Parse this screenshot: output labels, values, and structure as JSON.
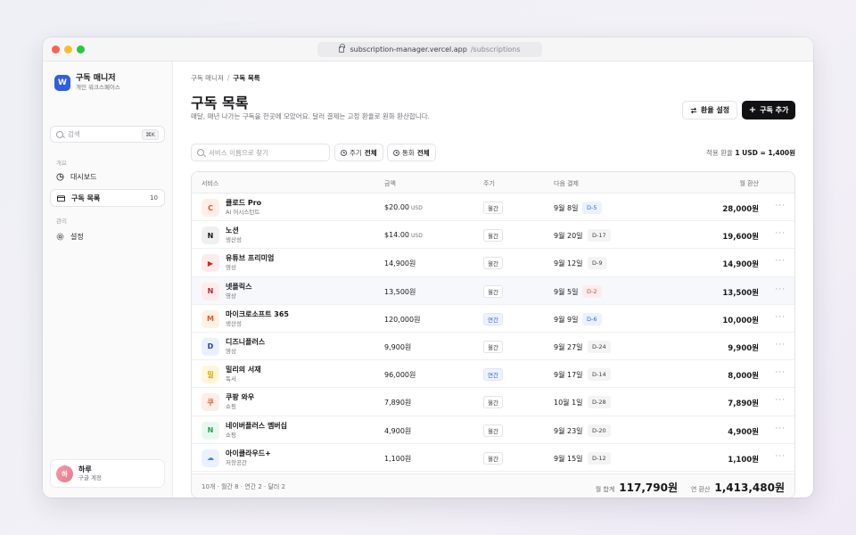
{
  "browser": {
    "url_host": "subscription-manager.vercel.app",
    "url_path": "/subscriptions"
  },
  "sidebar": {
    "logo_letter": "W",
    "app_name": "구독 매니저",
    "workspace": "개인 워크스페이스",
    "search_placeholder": "검색",
    "search_shortcut": "⌘K",
    "section_overview": "개요",
    "items": [
      {
        "label": "대시보드",
        "icon": "pie-chart-icon"
      },
      {
        "label": "구독 목록",
        "icon": "card-icon",
        "count": "10",
        "active": true
      }
    ],
    "section_manage": "관리",
    "settings_label": "설정",
    "user": {
      "initial": "하",
      "name": "하루",
      "account": "구글 계정"
    }
  },
  "header": {
    "breadcrumb_root": "구독 매니저",
    "breadcrumb_current": "구독 목록",
    "title": "구독 목록",
    "description": "매달, 매년 나가는 구독을 한곳에 모았어요. 달러 결제는 고정 환율로 원화 환산합니다.",
    "rate_button": "환율 설정",
    "add_button": "구독 추가"
  },
  "filters": {
    "search_placeholder": "서비스 이름으로 찾기",
    "cycle_label": "주기",
    "cycle_value": "전체",
    "currency_label": "통화",
    "currency_value": "전체",
    "rate_label": "적용 환율",
    "rate_value": "1 USD = 1,400원"
  },
  "table": {
    "headers": {
      "service": "서비스",
      "amount": "금액",
      "cycle": "주기",
      "next": "다음 결제",
      "monthly": "월 환산"
    },
    "rows": [
      {
        "icon": "C",
        "name": "클로드 Pro",
        "category": "AI 어시스턴트",
        "amount": "$20.00",
        "unit": "USD",
        "cycle": "월간",
        "next": "9월 8일",
        "dday": "D-5",
        "monthly": "28,000원"
      },
      {
        "icon": "N",
        "name": "노션",
        "category": "생산성",
        "amount": "$14.00",
        "unit": "USD",
        "cycle": "월간",
        "next": "9월 20일",
        "dday": "D-17",
        "monthly": "19,600원"
      },
      {
        "icon": "▶",
        "name": "유튜브 프리미엄",
        "category": "영상",
        "amount": "14,900원",
        "unit": "",
        "cycle": "월간",
        "next": "9월 12일",
        "dday": "D-9",
        "monthly": "14,900원"
      },
      {
        "icon": "N",
        "name": "넷플릭스",
        "category": "영상",
        "amount": "13,500원",
        "unit": "",
        "cycle": "월간",
        "next": "9월 5일",
        "dday": "D-2",
        "monthly": "13,500원"
      },
      {
        "icon": "M",
        "name": "마이크로소프트 365",
        "category": "생산성",
        "amount": "120,000원",
        "unit": "",
        "cycle": "연간",
        "next": "9월 9일",
        "dday": "D-6",
        "monthly": "10,000원"
      },
      {
        "icon": "D",
        "name": "디즈니플러스",
        "category": "영상",
        "amount": "9,900원",
        "unit": "",
        "cycle": "월간",
        "next": "9월 27일",
        "dday": "D-24",
        "monthly": "9,900원"
      },
      {
        "icon": "밀",
        "name": "밀리의 서재",
        "category": "독서",
        "amount": "96,000원",
        "unit": "",
        "cycle": "연간",
        "next": "9월 17일",
        "dday": "D-14",
        "monthly": "8,000원"
      },
      {
        "icon": "쿠",
        "name": "쿠팡 와우",
        "category": "쇼핑",
        "amount": "7,890원",
        "unit": "",
        "cycle": "월간",
        "next": "10월 1일",
        "dday": "D-28",
        "monthly": "7,890원"
      },
      {
        "icon": "N",
        "name": "네이버플러스 멤버십",
        "category": "쇼핑",
        "amount": "4,900원",
        "unit": "",
        "cycle": "월간",
        "next": "9월 23일",
        "dday": "D-20",
        "monthly": "4,900원"
      },
      {
        "icon": "☁",
        "name": "아이클라우드+",
        "category": "저장공간",
        "amount": "1,100원",
        "unit": "",
        "cycle": "월간",
        "next": "9월 15일",
        "dday": "D-12",
        "monthly": "1,100원"
      }
    ],
    "footer": {
      "summary": "10개 · 월간 8 · 연간 2 · 달러 2",
      "monthly_label": "월 합계",
      "monthly_total": "117,790원",
      "yearly_label": "연 환산",
      "yearly_total": "1,413,480원"
    }
  },
  "colors": {
    "accent": "#2f5fe0",
    "primary_button": "#111113",
    "urgent": "#d64545"
  }
}
